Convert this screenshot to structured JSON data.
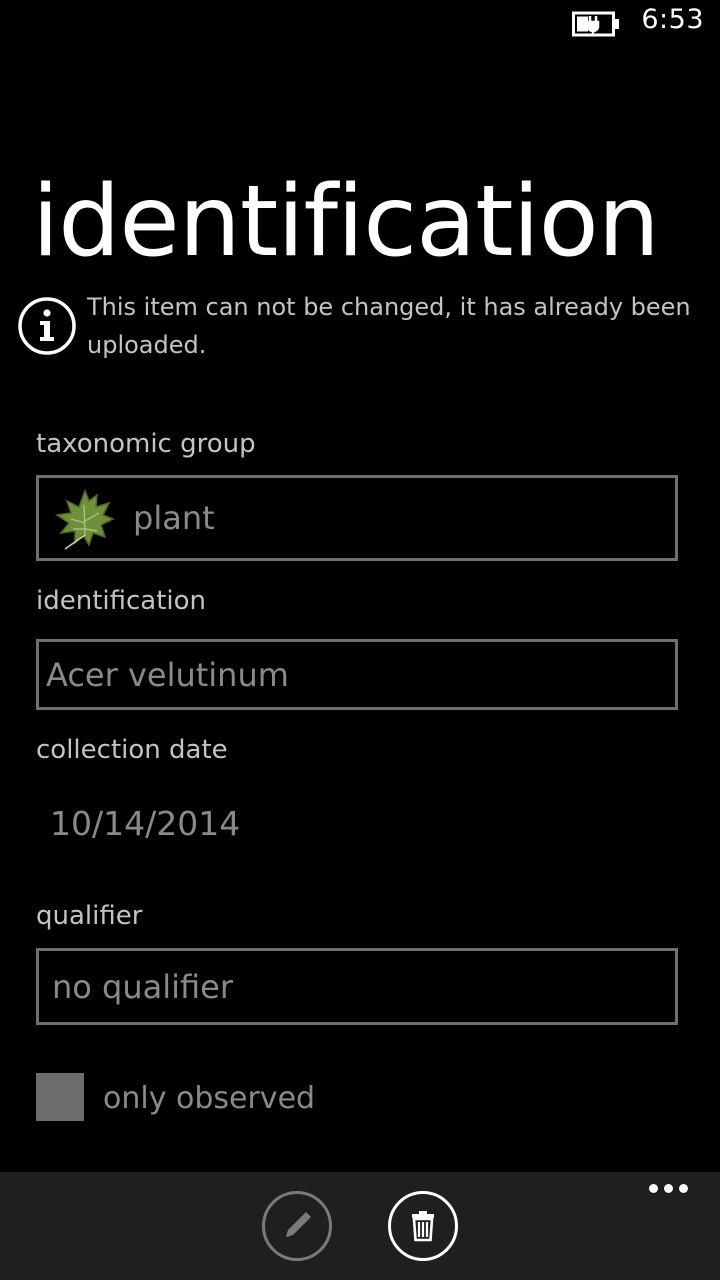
{
  "status_bar": {
    "time": "6:53",
    "battery_icon": "battery-charging-icon"
  },
  "page": {
    "title": "identification"
  },
  "notice": {
    "icon": "info-icon",
    "text": "This item can not be changed, it has already been uploaded."
  },
  "fields": {
    "taxonomic_group": {
      "label": "taxonomic group",
      "value": "plant",
      "icon": "leaf-icon"
    },
    "identification": {
      "label": "identification",
      "value": "Acer velutinum"
    },
    "collection_date": {
      "label": "collection date",
      "value": "10/14/2014"
    },
    "qualifier": {
      "label": "qualifier",
      "value": "no qualifier"
    },
    "only_observed": {
      "label": "only observed"
    }
  },
  "app_bar": {
    "edit_icon": "pencil-icon",
    "delete_icon": "trash-icon",
    "more_icon": "more-dots-icon"
  },
  "colors": {
    "background": "#000000",
    "app_bar": "#1f1f1f",
    "disabled_text": "#8a8a8a",
    "label_text": "#c4c4c4",
    "border": "#6f6f6f"
  }
}
